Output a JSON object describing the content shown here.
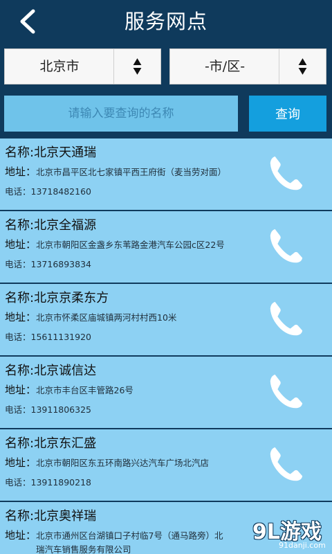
{
  "header": {
    "title": "服务网点",
    "back_icon": "back-arrow-icon"
  },
  "filter": {
    "province": "北京市",
    "city": "-市/区-",
    "search_placeholder": "请输入要查询的名称",
    "search_value": "",
    "search_button": "查询"
  },
  "colors": {
    "header_bg": "#0f3a5c",
    "item_bg": "#8dd1f3",
    "button_bg": "#149fde",
    "input_bg": "#6fc3ea"
  },
  "items": [
    {
      "name": "名称:北京天通瑞",
      "addr_label": "地址：",
      "addr": "北京市昌平区北七家镇平西王府街（麦当劳对面）",
      "tel_label": "电话：",
      "tel": "13718482160"
    },
    {
      "name": "名称:北京全福源",
      "addr_label": "地址：",
      "addr": "北京市朝阳区金盏乡东苇路金港汽车公园c区22号",
      "tel_label": "电话：",
      "tel": "13716893834"
    },
    {
      "name": "名称:北京京柔东方",
      "addr_label": "地址：",
      "addr": "北京市怀柔区庙城镇两河村村西10米",
      "tel_label": "电话：",
      "tel": "15611131920"
    },
    {
      "name": "名称:北京诚信达",
      "addr_label": "地址：",
      "addr": "北京市丰台区丰管路26号",
      "tel_label": "电话：",
      "tel": "13911806325"
    },
    {
      "name": "名称:北京东汇盛",
      "addr_label": "地址：",
      "addr": "北京市朝阳区东五环南路兴达汽车广场北汽店",
      "tel_label": "电话：",
      "tel": "13911890218"
    },
    {
      "name": "名称:北京奥祥瑞",
      "addr_label": "地址：",
      "addr": "北京市通州区台湖镇口子村临7号（通马路旁）北",
      "addr2": "瑞汽车销售服务有限公司"
    }
  ],
  "watermark": {
    "brand": "9L游戏",
    "url": "91danji.com"
  }
}
